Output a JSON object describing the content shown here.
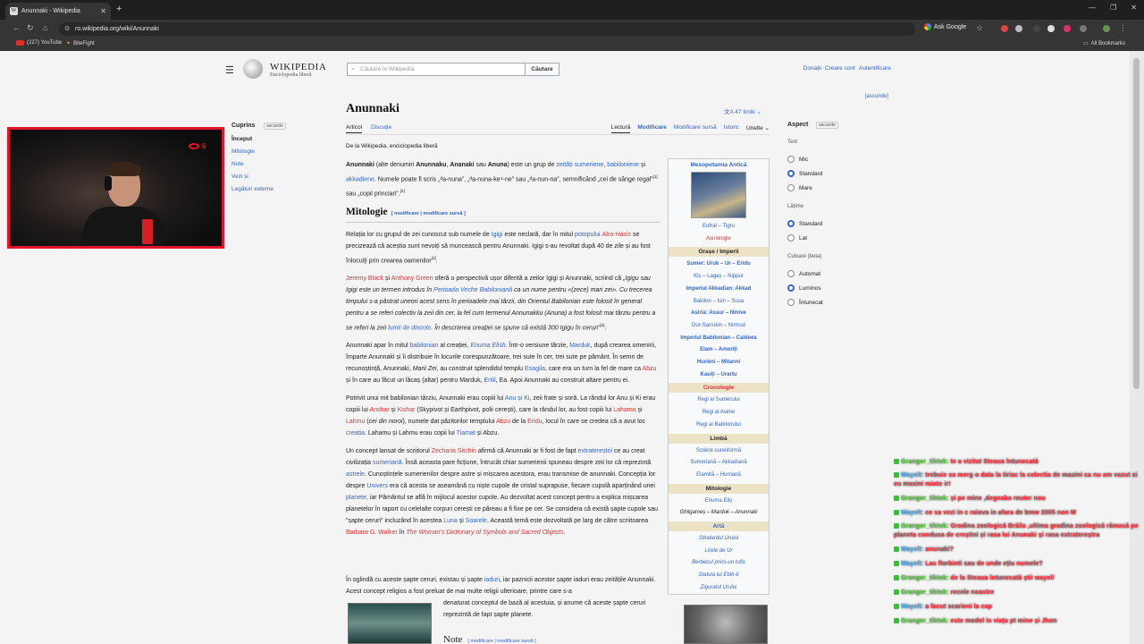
{
  "browser": {
    "tab_title": "Anunnaki - Wikipedia",
    "url": "ro.wikipedia.org/wiki/Anunnaki",
    "ask_google": "Ask Google",
    "bookmarks": [
      "(227) YouTube",
      "BiteFight"
    ],
    "all_bookmarks": "All Bookmarks"
  },
  "wiki": {
    "logo_name": "WIKIPEDIA",
    "logo_tagline": "Enciclopedia liberă",
    "search_placeholder": "Căutare în Wikipedia",
    "search_button": "Căutare",
    "top_links": [
      "Donații",
      "Creare cont",
      "Autentificare"
    ],
    "hide_top": "[ascunde]",
    "toc": {
      "title": "Cuprins",
      "hide": "ascunde",
      "items": [
        "Început",
        "Mitologie",
        "Note",
        "Vezi și",
        "Legături externe"
      ]
    },
    "title": "Anunnaki",
    "languages": "47 limbi",
    "tabs": {
      "article": "Articol",
      "discussion": "Discuție"
    },
    "views": [
      "Lectură",
      "Modificare",
      "Modificare sursă",
      "Istoric",
      "Unelte"
    ],
    "from": "De la Wikipedia, enciclopedia liberă",
    "section_mitologie": "Mitologie",
    "section_edit": "[ modificare | modificare sursă ]",
    "note_heading": "Note",
    "note_edit": "[ modificare | modificare sursă ]"
  },
  "infobox": {
    "title": "Mesopotamia Antică",
    "rows1": [
      "Eufrat – Tigru",
      "Asiriologie"
    ],
    "head_cities": "Orașe / Imperii",
    "cities": [
      "Sumer: Uruk – Ur – Eridu",
      "Kiș – Lagaș – Nippur",
      "Imperiul Akkadian: Akkad",
      "Babilon – Isin – Susa",
      "Asiria: Assur – Ninive",
      "Dur-Sarrukin – Nimrud",
      "Imperiul Babilonian – Caldeea",
      "Elam – Amoriți",
      "Hurieni – Mitanni",
      "Kasiți – Urartu"
    ],
    "head_chron": "Cronologie",
    "chron": [
      "Regi ai Sumerului",
      "Regi ai Asiriei",
      "Regi ai Babilonului"
    ],
    "head_lang": "Limbă",
    "lang": [
      "Scriere cuneiformă",
      "Sumeriană – Akkadiană",
      "Elamită – Hurriană"
    ],
    "head_myth": "Mitologie",
    "myth": [
      "Enuma Eliș",
      "Ghilgameș – Marduk – Anunnaki"
    ],
    "head_art": "Artă",
    "art": [
      "Stindardul Urului",
      "Lirele de Ur",
      "Berbecul prins-un tufiș",
      "Statuia lui Ebih-Il",
      "Ziguratul Urului"
    ]
  },
  "aspect": {
    "title": "Aspect",
    "hide": "ascunde",
    "text_label": "Text",
    "text_opts": [
      "Mic",
      "Standard",
      "Mare"
    ],
    "width_label": "Lățime",
    "width_opts": [
      "Standard",
      "Lat"
    ],
    "color_label": "Culoare (beta)",
    "color_opts": [
      "Automat",
      "Luminos",
      "Întunecat"
    ]
  },
  "webcam": {
    "viewers": "6"
  },
  "chat": [
    {
      "user": "Granger_tiktok",
      "text": "te a vizitat Steaua întunecată"
    },
    {
      "user": "Wayelt",
      "text": "trebuie sa merg o data la tiriac la colectia de masini ca nu am vazut si eu masini miato ir!"
    },
    {
      "user": "Granger_tiktok",
      "text": "și pe mine ,degeaba router nou"
    },
    {
      "user": "Wayelt",
      "text": "ce sa vezi in c raiova in afara de bmw 2005 non M"
    },
    {
      "user": "Granger_tiktok",
      "text": "Gradina zoologică Brăila ,ultima gradina zoologică rămasă pe planeta condusa de creștini și rasa lui Anunaki și rasa extratereștra"
    },
    {
      "user": "Wayelt",
      "text": "anunaki?"
    },
    {
      "user": "Wayelt",
      "text": "Las florbinti sau de unde ețiu numele?"
    },
    {
      "user": "Granger_tiktok",
      "text": "de la Steaua întunecată știi wayel/"
    },
    {
      "user": "Granger_tiktok",
      "text": "recele noastre"
    },
    {
      "user": "Wayelt",
      "text": "a facut scarieni la cap"
    },
    {
      "user": "Granger_tiktok",
      "text": "este model in viața pt mine și Jhon"
    }
  ]
}
